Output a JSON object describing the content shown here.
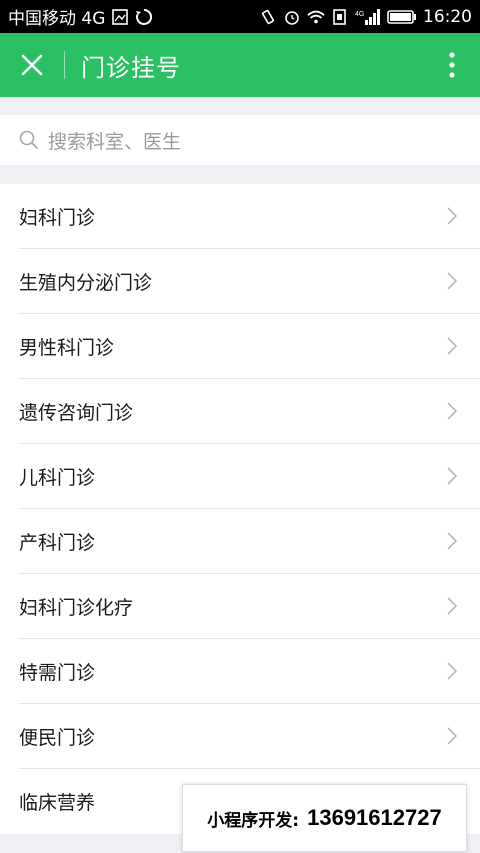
{
  "status_bar": {
    "carrier": "中国移动 4G",
    "network": "4G",
    "time": "16:20"
  },
  "header": {
    "title": "门诊挂号",
    "close_icon": "close-icon",
    "more_icon": "more-vertical-icon"
  },
  "search": {
    "placeholder": "搜索科室、医生",
    "icon": "search-icon"
  },
  "departments": [
    {
      "label": "妇科门诊"
    },
    {
      "label": "生殖内分泌门诊"
    },
    {
      "label": "男性科门诊"
    },
    {
      "label": "遗传咨询门诊"
    },
    {
      "label": "儿科门诊"
    },
    {
      "label": "产科门诊"
    },
    {
      "label": "妇科门诊化疗"
    },
    {
      "label": "特需门诊"
    },
    {
      "label": "便民门诊"
    },
    {
      "label": "临床营养"
    }
  ],
  "promo": {
    "label": "小程序开发:",
    "number": "13691612727"
  },
  "colors": {
    "accent": "#2bc064",
    "statusbar": "#000000",
    "background": "#efeff4"
  }
}
